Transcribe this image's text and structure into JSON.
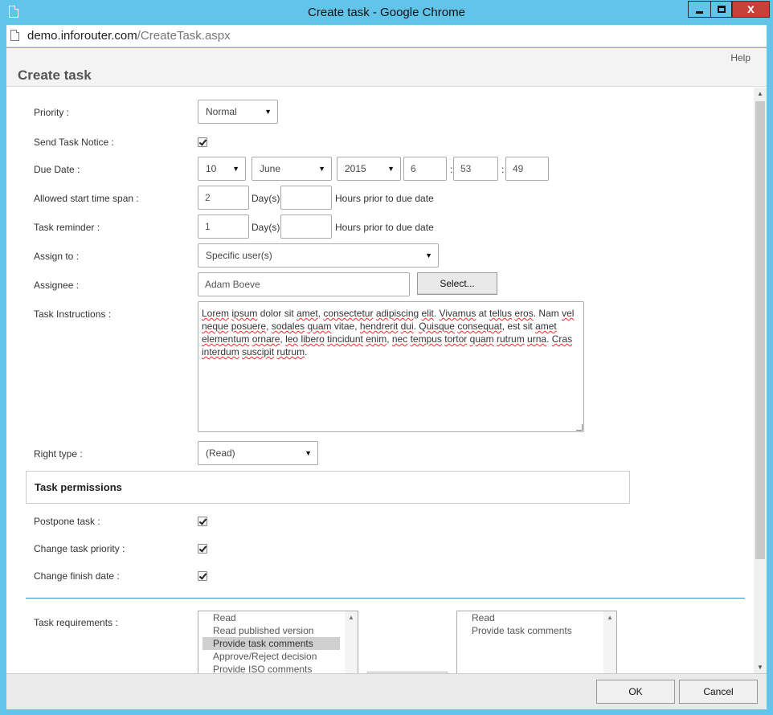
{
  "window": {
    "title": "Create task - Google Chrome",
    "minimize": "",
    "maximize": "",
    "close": "x"
  },
  "address": {
    "host": "demo.inforouter.com",
    "path": "/CreateTask.aspx"
  },
  "header": {
    "help": "Help",
    "title": "Create task"
  },
  "form": {
    "priority": {
      "label": "Priority :",
      "value": "Normal"
    },
    "send_notice": {
      "label": "Send Task Notice :",
      "checked": true
    },
    "due_date": {
      "label": "Due Date :",
      "day": "10",
      "month": "June",
      "year": "2015",
      "hour": "6",
      "minute": "53",
      "second": "49",
      "sep1": ":",
      "sep2": ":"
    },
    "start_span": {
      "label": "Allowed start time span :",
      "days": "2",
      "days_unit": "Day(s)",
      "hours": "",
      "hours_suffix": "Hours prior to due date"
    },
    "reminder": {
      "label": "Task reminder :",
      "days": "1",
      "days_unit": "Day(s)",
      "hours": "",
      "hours_suffix": "Hours prior to due date"
    },
    "assign_to": {
      "label": "Assign to :",
      "value": "Specific user(s)"
    },
    "assignee": {
      "label": "Assignee :",
      "value": "Adam Boeve",
      "select_button": "Select..."
    },
    "instructions": {
      "label": "Task Instructions :",
      "text_parts": [
        "Lorem",
        " ",
        "ipsum",
        " dolor sit ",
        "amet",
        ", ",
        "consectetur",
        " ",
        "adipiscing",
        " ",
        "elit",
        ". ",
        "Vivamus",
        " at ",
        "tellus",
        " ",
        "eros",
        ". Nam ",
        "vel",
        " ",
        "neque",
        " ",
        "posuere",
        ", ",
        "sodales",
        " ",
        "quam",
        " vitae, ",
        "hendrerit",
        " ",
        "dui",
        ". ",
        "Quisque",
        " ",
        "consequat",
        ", est sit ",
        "amet",
        " ",
        "elementum",
        " ",
        "ornare",
        ", ",
        "leo",
        " ",
        "libero",
        " ",
        "tincidunt",
        " ",
        "enim",
        ", ",
        "nec",
        " ",
        "tempus",
        " ",
        "tortor",
        " ",
        "quam",
        " ",
        "rutrum",
        " ",
        "urna",
        ". ",
        "Cras",
        " ",
        "interdum",
        " ",
        "suscipit",
        " ",
        "rutrum",
        "."
      ]
    },
    "right_type": {
      "label": "Right type :",
      "value": "(Read)"
    },
    "permissions": {
      "title": "Task permissions",
      "postpone": {
        "label": "Postpone task :",
        "checked": true
      },
      "change_priority": {
        "label": "Change task priority :",
        "checked": true
      },
      "change_finish": {
        "label": "Change finish date :",
        "checked": true
      }
    },
    "requirements": {
      "label": "Task requirements :",
      "available": [
        "Read",
        "Read published version",
        "Provide task comments",
        "Approve/Reject decision",
        "Provide ISO comments"
      ],
      "available_selected_index": 2,
      "chosen": [
        "Read",
        "Provide task comments"
      ]
    }
  },
  "footer": {
    "ok": "OK",
    "cancel": "Cancel"
  }
}
